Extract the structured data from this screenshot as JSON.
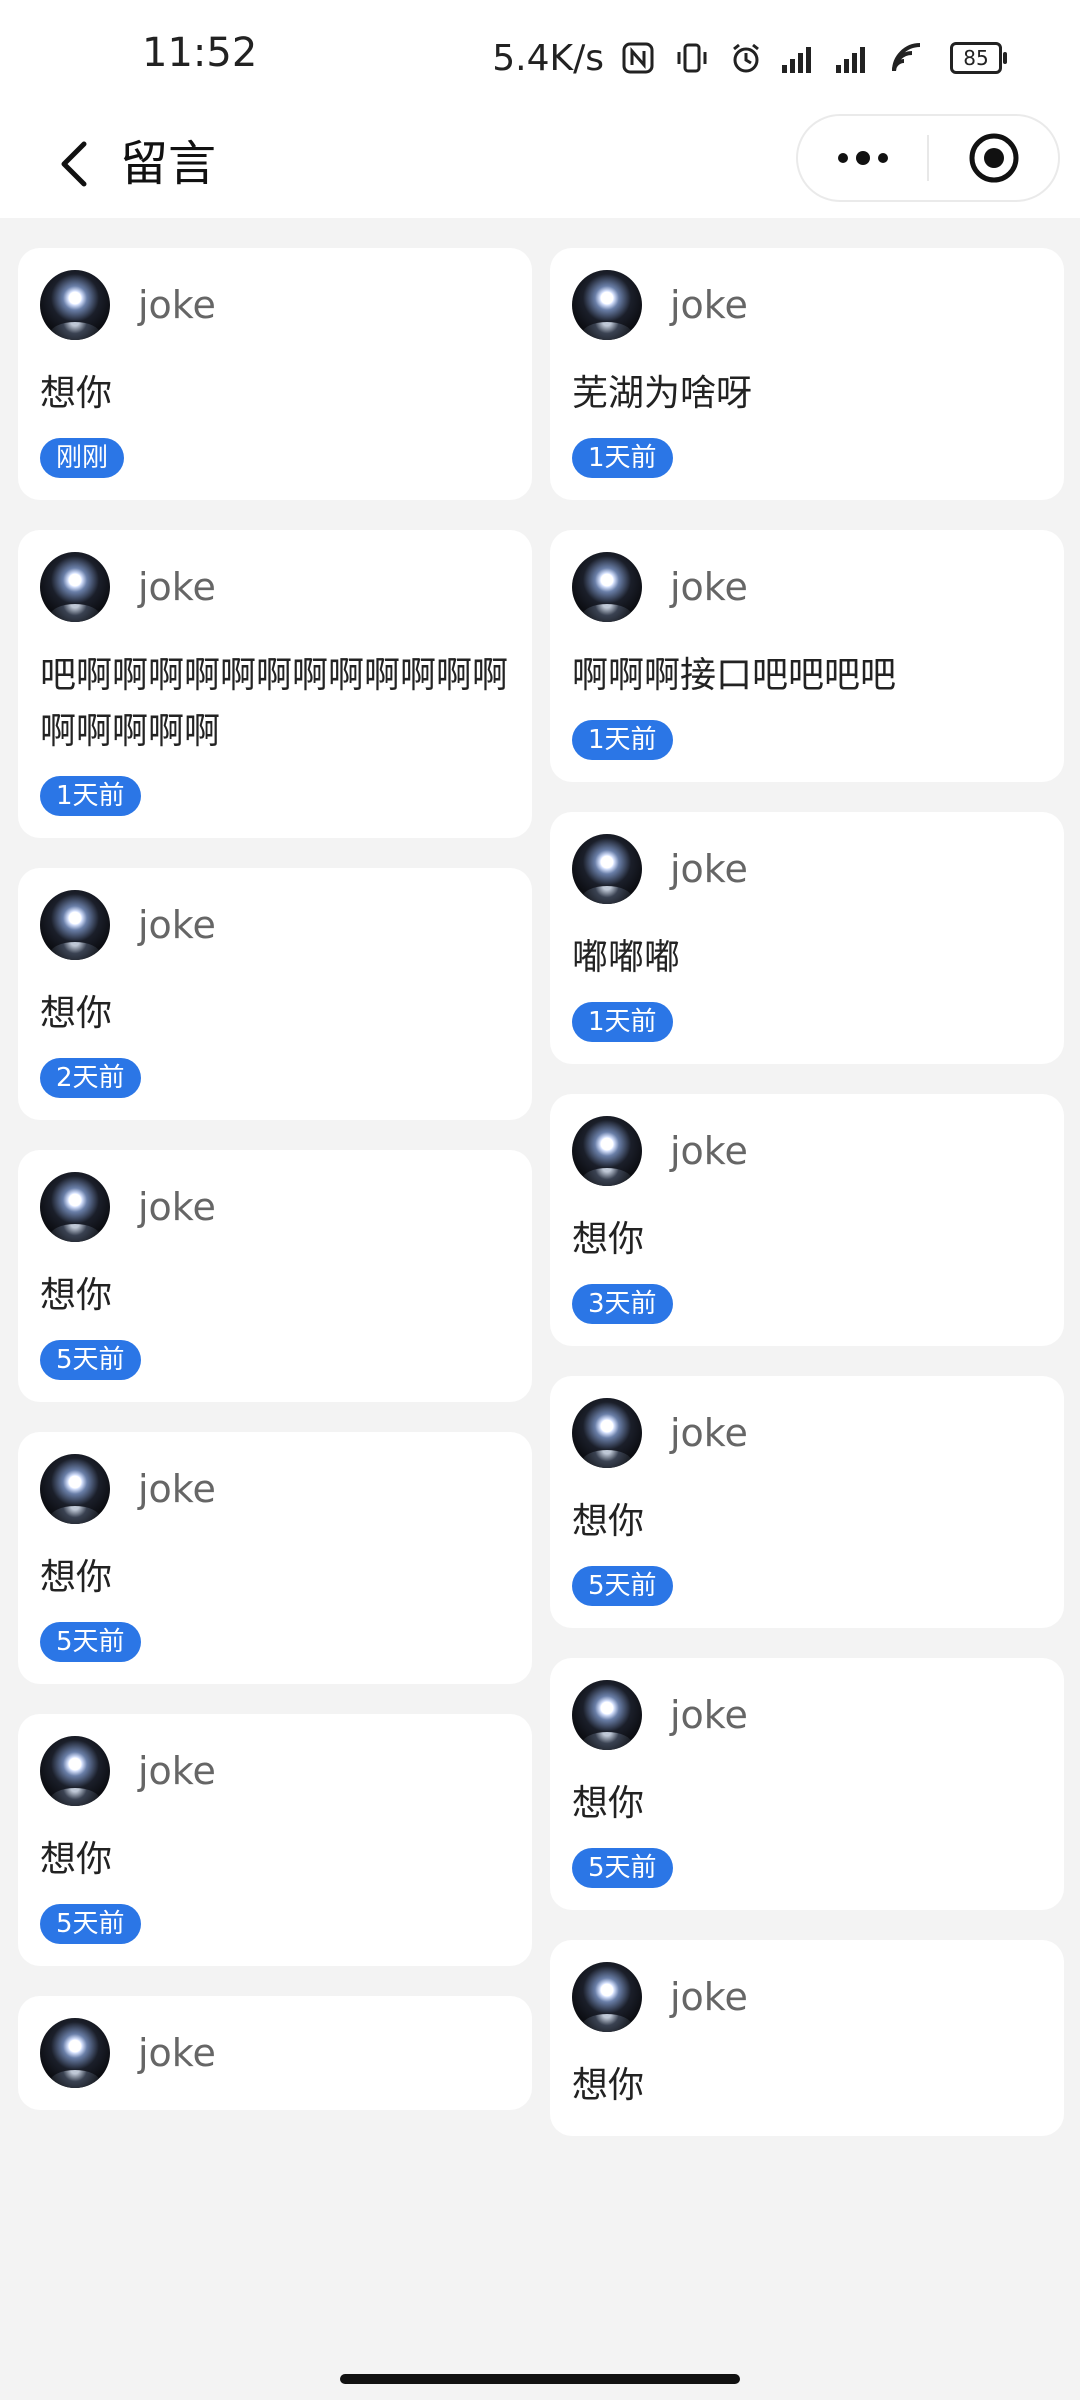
{
  "status_bar": {
    "time": "11:52",
    "net_speed": "5.4K/s",
    "battery": "85"
  },
  "nav": {
    "title": "留言"
  },
  "messages_left": [
    {
      "user": "joke",
      "text": "想你",
      "time": "刚刚"
    },
    {
      "user": "joke",
      "text": "吧啊啊啊啊啊啊啊啊啊啊啊啊啊啊啊啊啊",
      "time": "1天前"
    },
    {
      "user": "joke",
      "text": "想你",
      "time": "2天前"
    },
    {
      "user": "joke",
      "text": "想你",
      "time": "5天前"
    },
    {
      "user": "joke",
      "text": "想你",
      "time": "5天前"
    },
    {
      "user": "joke",
      "text": "想你",
      "time": "5天前"
    },
    {
      "user": "joke",
      "text": "",
      "time": ""
    }
  ],
  "messages_right": [
    {
      "user": "joke",
      "text": "芜湖为啥呀",
      "time": "1天前"
    },
    {
      "user": "joke",
      "text": "啊啊啊接口吧吧吧吧",
      "time": "1天前"
    },
    {
      "user": "joke",
      "text": "嘟嘟嘟",
      "time": "1天前"
    },
    {
      "user": "joke",
      "text": "想你",
      "time": "3天前"
    },
    {
      "user": "joke",
      "text": "想你",
      "time": "5天前"
    },
    {
      "user": "joke",
      "text": "想你",
      "time": "5天前"
    },
    {
      "user": "joke",
      "text": "想你",
      "time": ""
    }
  ]
}
